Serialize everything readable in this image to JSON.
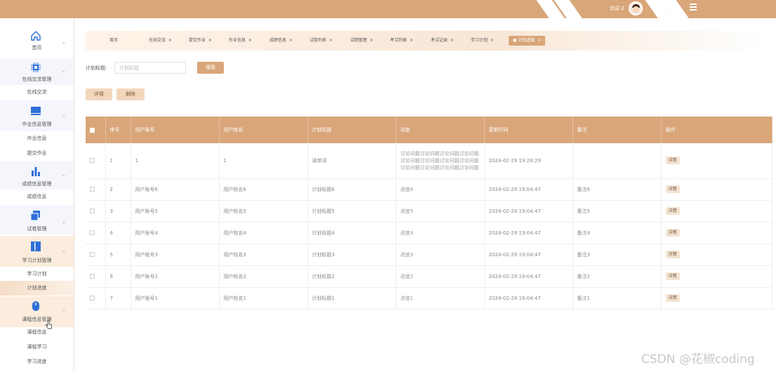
{
  "header": {
    "welcome": "欢迎 2",
    "menu_icon": "hamburger-icon",
    "accent_color": "#d9a67a"
  },
  "sidebar": {
    "groups": [
      {
        "label": "首页",
        "icon": "home-icon",
        "chevron": "⌄"
      },
      {
        "label": "在线交流管理",
        "icon": "chip-icon",
        "chevron": "⌃"
      },
      {
        "label": "作业信息管理",
        "icon": "monitor-icon",
        "chevron": "⌃"
      },
      {
        "label": "成绩信息管理",
        "icon": "bar-chart-icon",
        "chevron": "⌃"
      },
      {
        "label": "试卷管理",
        "icon": "copy-icon",
        "chevron": "⌄"
      },
      {
        "label": "学习计划管理",
        "icon": "book-icon",
        "chevron": "⌃"
      },
      {
        "label": "课程信息管理",
        "icon": "mouse-icon",
        "chevron": "⌃"
      }
    ],
    "subitems": {
      "chat": [
        "在线交流"
      ],
      "homework": [
        "作业信息",
        "提交作业"
      ],
      "grades": [
        "成绩信息"
      ],
      "plan": [
        "学习计划",
        "计划进度"
      ],
      "course": [
        "课程信息",
        "课程学习",
        "学习进度"
      ]
    }
  },
  "tabs": [
    "首页",
    "在线交流",
    "提交作业",
    "作业信息",
    "成绩信息",
    "试卷列表",
    "试题管理",
    "考试列表",
    "考试记录",
    "学习计划",
    "计划进度"
  ],
  "search": {
    "label": "计划标题:",
    "placeholder": "计划标题",
    "button": "搜索"
  },
  "actions": {
    "detail": "详情",
    "delete": "删除"
  },
  "table": {
    "columns": [
      "序号",
      "用户账号",
      "用户姓名",
      "计划标题",
      "进度",
      "更新时间",
      "备注",
      "操作"
    ],
    "rows": [
      {
        "no": "1",
        "account": "1",
        "name": "1",
        "title": "读单词",
        "progress": "讨论问题讨论问题讨论问题讨论问题讨论问题讨论问题讨论问题讨论问题讨论问题讨论问题讨论问题讨论问题",
        "time": "2024-02-29 19:28:29",
        "note": "",
        "op": "详情"
      },
      {
        "no": "2",
        "account": "用户账号6",
        "name": "用户姓名6",
        "title": "计划标题6",
        "progress": "进度6",
        "time": "2024-02-29 19:04:47",
        "note": "备注6",
        "op": "详情"
      },
      {
        "no": "3",
        "account": "用户账号5",
        "name": "用户姓名5",
        "title": "计划标题5",
        "progress": "进度5",
        "time": "2024-02-29 19:04:47",
        "note": "备注5",
        "op": "详情"
      },
      {
        "no": "4",
        "account": "用户账号4",
        "name": "用户姓名4",
        "title": "计划标题4",
        "progress": "进度4",
        "time": "2024-02-29 19:04:47",
        "note": "备注4",
        "op": "详情"
      },
      {
        "no": "5",
        "account": "用户账号3",
        "name": "用户姓名3",
        "title": "计划标题3",
        "progress": "进度3",
        "time": "2024-02-29 19:04:47",
        "note": "备注3",
        "op": "详情"
      },
      {
        "no": "6",
        "account": "用户账号2",
        "name": "用户姓名2",
        "title": "计划标题2",
        "progress": "进度2",
        "time": "2024-02-29 19:04:47",
        "note": "备注2",
        "op": "详情"
      },
      {
        "no": "7",
        "account": "用户账号1",
        "name": "用户姓名1",
        "title": "计划标题1",
        "progress": "进度1",
        "time": "2024-02-29 19:04:47",
        "note": "备注1",
        "op": "详情"
      }
    ]
  },
  "watermark": "CSDN @花椒coding"
}
